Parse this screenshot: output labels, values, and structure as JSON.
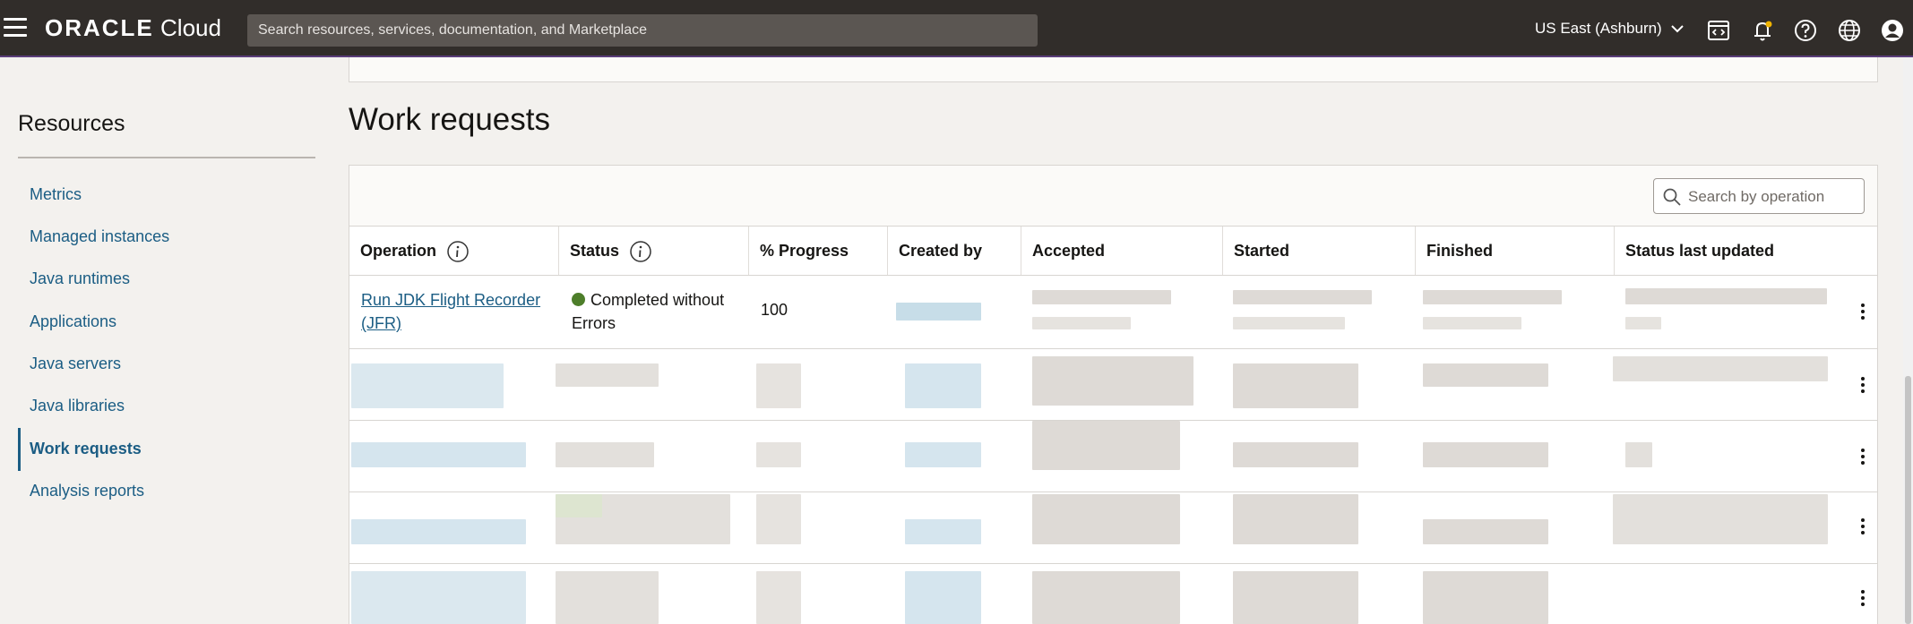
{
  "header": {
    "logo_brand": "ORACLE",
    "logo_product": "Cloud",
    "search_placeholder": "Search resources, services, documentation, and Marketplace",
    "region": "US East (Ashburn)"
  },
  "sidebar": {
    "title": "Resources",
    "items": [
      {
        "label": "Metrics",
        "active": false
      },
      {
        "label": "Managed instances",
        "active": false
      },
      {
        "label": "Java runtimes",
        "active": false
      },
      {
        "label": "Applications",
        "active": false
      },
      {
        "label": "Java servers",
        "active": false
      },
      {
        "label": "Java libraries",
        "active": false
      },
      {
        "label": "Work requests",
        "active": true
      },
      {
        "label": "Analysis reports",
        "active": false
      }
    ]
  },
  "main": {
    "title": "Work requests",
    "search_placeholder": "Search by operation",
    "columns": [
      "Operation",
      "Status",
      "% Progress",
      "Created by",
      "Accepted",
      "Started",
      "Finished",
      "Status last updated"
    ],
    "rows": [
      {
        "operation": "Run JDK Flight Recorder (JFR)",
        "status": "Completed without Errors",
        "progress": "100"
      }
    ]
  },
  "colors": {
    "topbar": "#312d2a",
    "link": "#1b5d84",
    "status_ok": "#4d7e2a"
  }
}
